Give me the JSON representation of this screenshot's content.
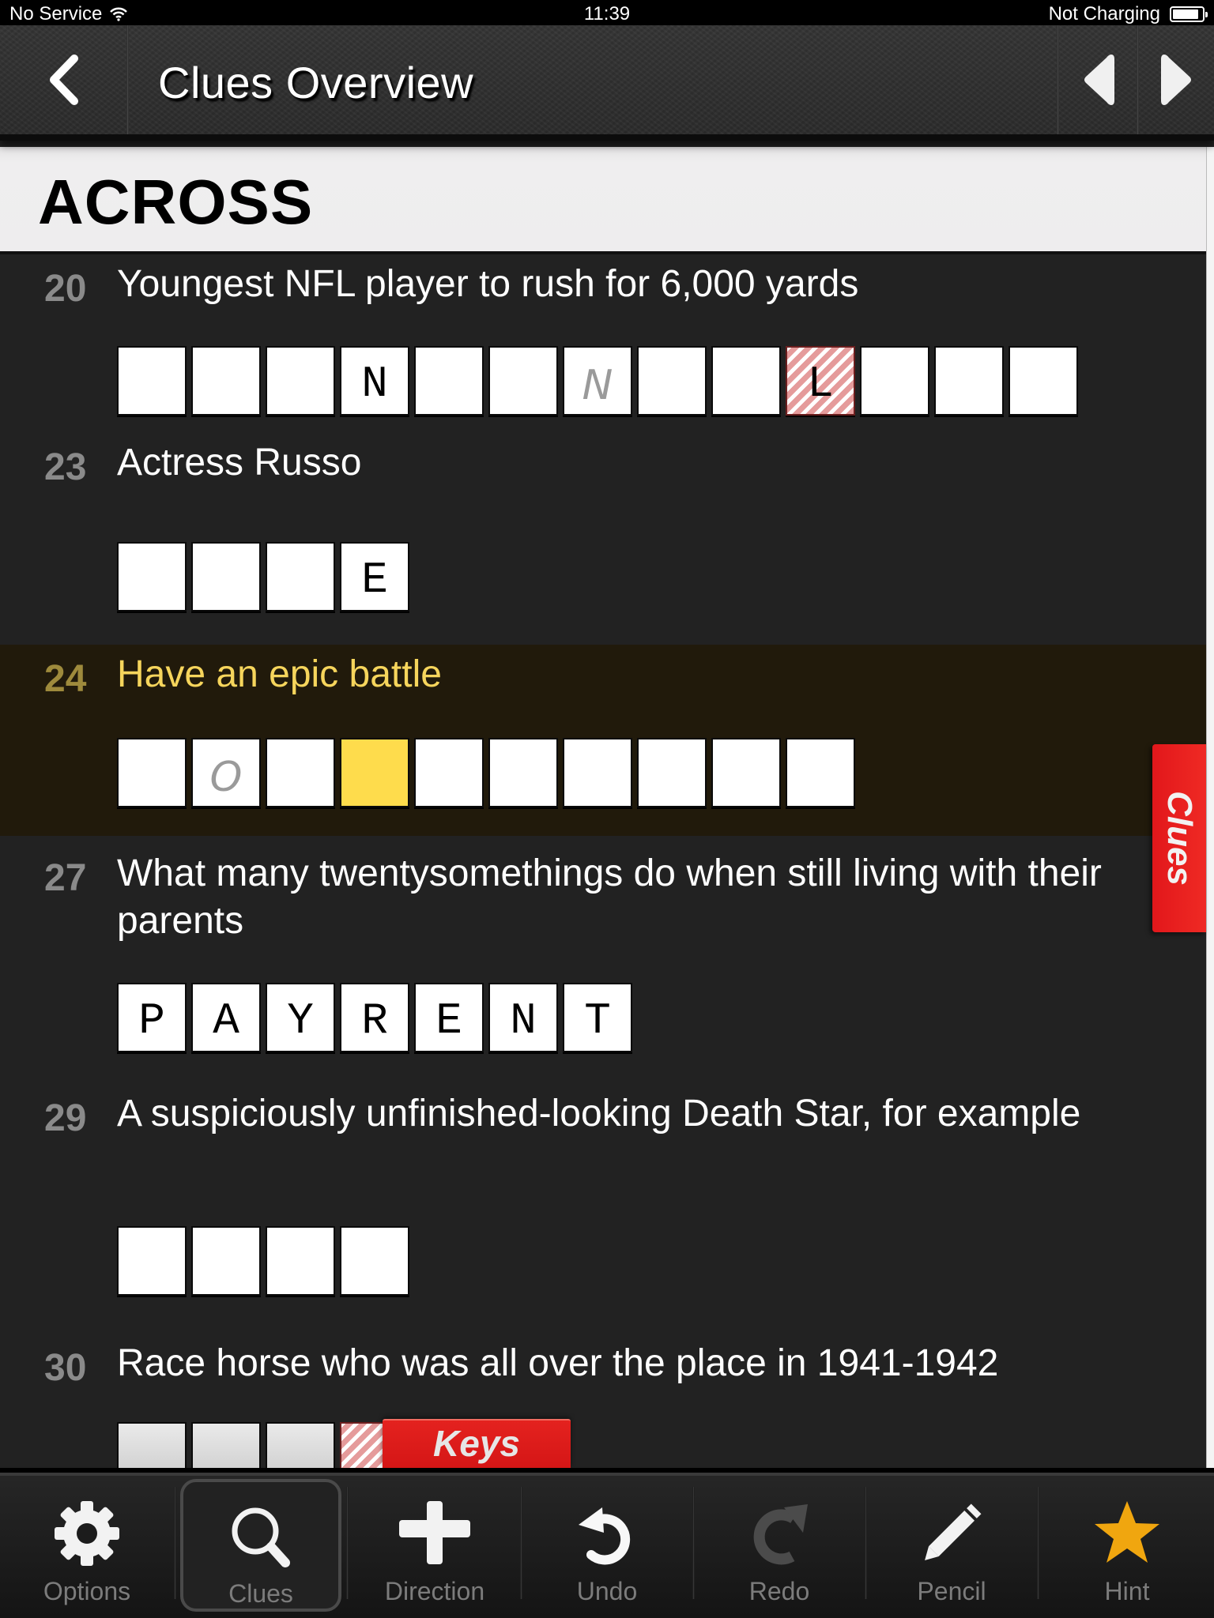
{
  "status_bar": {
    "carrier": "No Service",
    "wifi_icon": "wifi-icon",
    "time": "11:39",
    "charging_status": "Not Charging",
    "battery_level": 0.9
  },
  "header": {
    "title": "Clues Overview",
    "back_icon": "chevron-left-icon",
    "prev_icon": "triangle-left-icon",
    "next_icon": "triangle-right-icon"
  },
  "section": {
    "title": "ACROSS"
  },
  "clues": [
    {
      "number": "20",
      "text": "Youngest NFL player to rush for 6,000 yards",
      "active": false,
      "cells": [
        {
          "letter": "",
          "state": "empty"
        },
        {
          "letter": "",
          "state": "empty"
        },
        {
          "letter": "",
          "state": "empty"
        },
        {
          "letter": "N",
          "state": "filled"
        },
        {
          "letter": "",
          "state": "empty"
        },
        {
          "letter": "",
          "state": "empty"
        },
        {
          "letter": "N",
          "state": "pencil"
        },
        {
          "letter": "",
          "state": "empty"
        },
        {
          "letter": "",
          "state": "empty"
        },
        {
          "letter": "L",
          "state": "revealed"
        },
        {
          "letter": "",
          "state": "empty"
        },
        {
          "letter": "",
          "state": "empty"
        },
        {
          "letter": "",
          "state": "empty"
        }
      ]
    },
    {
      "number": "23",
      "text": "Actress Russo",
      "active": false,
      "cells": [
        {
          "letter": "",
          "state": "empty"
        },
        {
          "letter": "",
          "state": "empty"
        },
        {
          "letter": "",
          "state": "empty"
        },
        {
          "letter": "E",
          "state": "filled"
        }
      ]
    },
    {
      "number": "24",
      "text": "Have an epic battle",
      "active": true,
      "cells": [
        {
          "letter": "",
          "state": "empty"
        },
        {
          "letter": "O",
          "state": "pencil"
        },
        {
          "letter": "",
          "state": "empty"
        },
        {
          "letter": "",
          "state": "current"
        },
        {
          "letter": "",
          "state": "empty"
        },
        {
          "letter": "",
          "state": "empty"
        },
        {
          "letter": "",
          "state": "empty"
        },
        {
          "letter": "",
          "state": "empty"
        },
        {
          "letter": "",
          "state": "empty"
        },
        {
          "letter": "",
          "state": "empty"
        }
      ]
    },
    {
      "number": "27",
      "text": "What many twentysomethings do when still living with their parents",
      "active": false,
      "cells": [
        {
          "letter": "P",
          "state": "filled"
        },
        {
          "letter": "A",
          "state": "filled"
        },
        {
          "letter": "Y",
          "state": "filled"
        },
        {
          "letter": "R",
          "state": "filled"
        },
        {
          "letter": "E",
          "state": "filled"
        },
        {
          "letter": "N",
          "state": "filled"
        },
        {
          "letter": "T",
          "state": "filled"
        }
      ]
    },
    {
      "number": "29",
      "text": "A suspiciously unfinished-looking Death Star, for example",
      "active": false,
      "cells": [
        {
          "letter": "",
          "state": "empty"
        },
        {
          "letter": "",
          "state": "empty"
        },
        {
          "letter": "",
          "state": "empty"
        },
        {
          "letter": "",
          "state": "empty"
        }
      ]
    },
    {
      "number": "30",
      "text": "Race horse who was all over the place in 1941-1942",
      "active": false,
      "cells": [
        {
          "letter": "",
          "state": "empty"
        },
        {
          "letter": "",
          "state": "empty"
        },
        {
          "letter": "",
          "state": "empty"
        },
        {
          "letter": "",
          "state": "revealed"
        }
      ]
    }
  ],
  "side_tabs": {
    "clues": "Clues",
    "keys": "Keys"
  },
  "toolbar": {
    "items": [
      {
        "label": "Options",
        "icon": "gear-icon",
        "selected": false
      },
      {
        "label": "Clues",
        "icon": "search-icon",
        "selected": true
      },
      {
        "label": "Direction",
        "icon": "plus-icon",
        "selected": false
      },
      {
        "label": "Undo",
        "icon": "undo-icon",
        "selected": false
      },
      {
        "label": "Redo",
        "icon": "redo-icon",
        "selected": false,
        "disabled": true
      },
      {
        "label": "Pencil",
        "icon": "pencil-icon",
        "selected": false
      },
      {
        "label": "Hint",
        "icon": "star-icon",
        "selected": false
      }
    ]
  },
  "colors": {
    "active_clue_text": "#f6d55c",
    "current_cell": "#fedc4c",
    "tab_red": "#e2171b",
    "hint_star": "#f0a60f",
    "revealed_stripe": "#e59b9b"
  }
}
